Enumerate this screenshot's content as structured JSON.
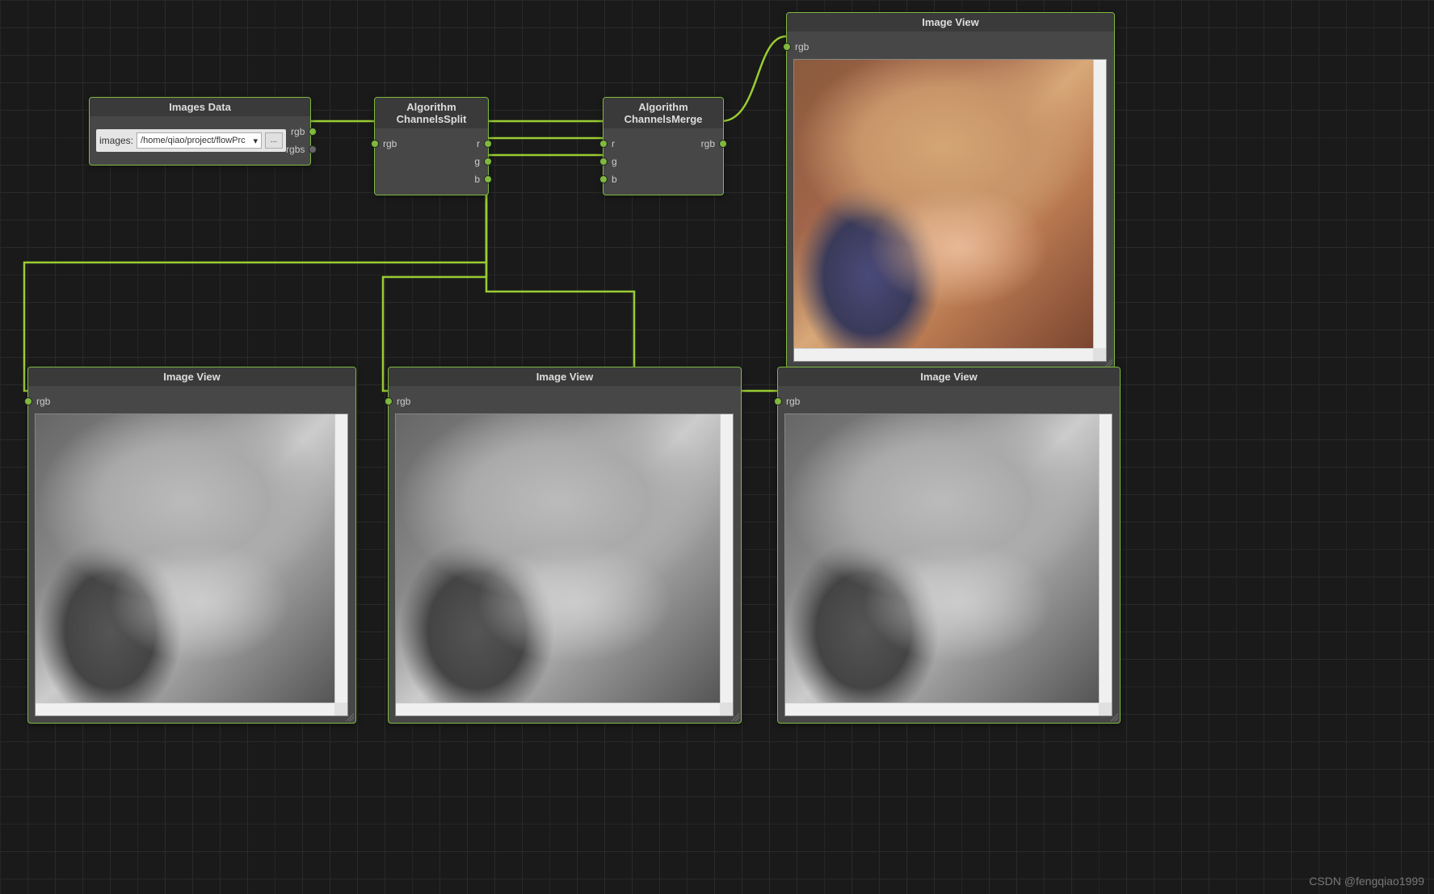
{
  "watermark": "CSDN @fengqiao1999",
  "nodes": {
    "images_data": {
      "title": "Images Data",
      "images_label": "images:",
      "path": "/home/qiao/project/flowPrc",
      "browse": "...",
      "out_rgb": "rgb",
      "out_rgbs": "rgbs"
    },
    "split": {
      "title": "Algorithm ChannelsSplit",
      "in_rgb": "rgb",
      "out_r": "r",
      "out_g": "g",
      "out_b": "b"
    },
    "merge": {
      "title": "Algorithm ChannelsMerge",
      "in_r": "r",
      "in_g": "g",
      "in_b": "b",
      "out_rgb": "rgb"
    },
    "view_tr": {
      "title": "Image View",
      "in_rgb": "rgb"
    },
    "view_bl": {
      "title": "Image View",
      "in_rgb": "rgb"
    },
    "view_bm": {
      "title": "Image View",
      "in_rgb": "rgb"
    },
    "view_br": {
      "title": "Image View",
      "in_rgb": "rgb"
    }
  }
}
